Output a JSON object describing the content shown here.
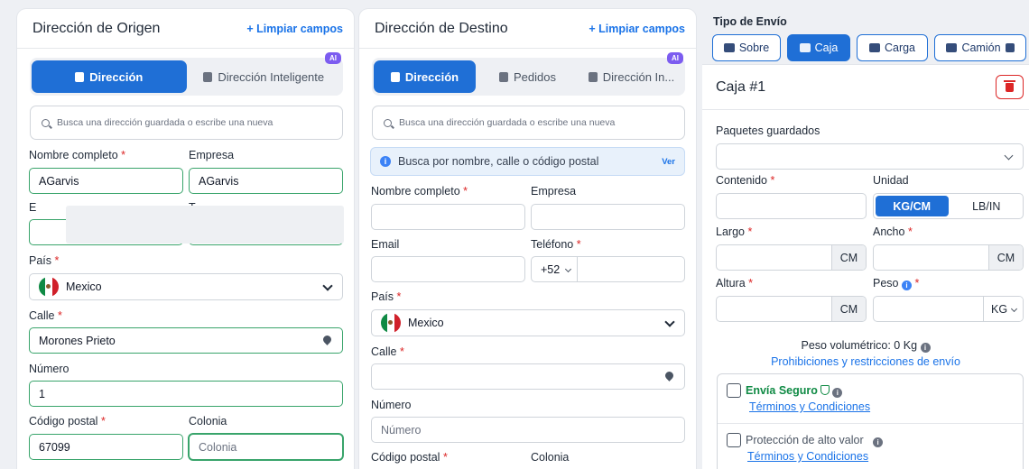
{
  "origin": {
    "title": "Dirección de Origen",
    "clear": "+ Limpiar campos",
    "tabs": [
      "Dirección",
      "Dirección Inteligente"
    ],
    "ai_badge": "AI",
    "search_placeholder": "Busca una dirección guardada o escribe una nueva",
    "labels": {
      "full_name": "Nombre completo",
      "company": "Empresa",
      "email": "E",
      "phone": "T",
      "country": "País",
      "street": "Calle",
      "number": "Número",
      "postal": "Código postal",
      "colonia": "Colonia"
    },
    "values": {
      "full_name": "AGarvis",
      "company": "AGarvis",
      "country": "Mexico",
      "street": "Morones Prieto",
      "number": "1",
      "postal": "67099",
      "colonia_placeholder": "Colonia"
    }
  },
  "destination": {
    "title": "Dirección de Destino",
    "clear": "+ Limpiar campos",
    "tabs": [
      "Dirección",
      "Pedidos",
      "Dirección In..."
    ],
    "ai_badge": "AI",
    "search_placeholder": "Busca una dirección guardada o escribe una nueva",
    "info_text": "Busca por nombre, calle o código postal",
    "info_link": "Ver",
    "labels": {
      "full_name": "Nombre completo",
      "company": "Empresa",
      "email": "Email",
      "phone": "Teléfono",
      "country": "País",
      "street": "Calle",
      "number": "Número",
      "postal": "Código postal",
      "colonia": "Colonia"
    },
    "values": {
      "phone_prefix": "+52",
      "country": "Mexico",
      "number_placeholder": "Número"
    }
  },
  "shipping": {
    "title": "Tipo de Envío",
    "types": [
      "Sobre",
      "Caja",
      "Carga",
      "Camión"
    ],
    "active_type": "Caja",
    "box_title": "Caja #1",
    "saved_packages": "Paquetes guardados",
    "content": "Contenido",
    "unit": "Unidad",
    "unit_options": [
      "KG/CM",
      "LB/IN"
    ],
    "length": "Largo",
    "width": "Ancho",
    "height": "Altura",
    "weight": "Peso",
    "cm": "CM",
    "kg": "KG",
    "volumetric": "Peso volumétrico: 0 Kg",
    "restrictions": "Prohibiciones y restricciones de envío",
    "secure": "Envía Seguro",
    "terms": "Términos y Condiciones",
    "high_value": "Protección de alto valor",
    "terms2": "Términos y Condiciones",
    "colors": {
      "accent": "#1f6fd6",
      "valid": "#39a46b",
      "required": "#dc2626",
      "secure": "#0f8a44"
    }
  }
}
